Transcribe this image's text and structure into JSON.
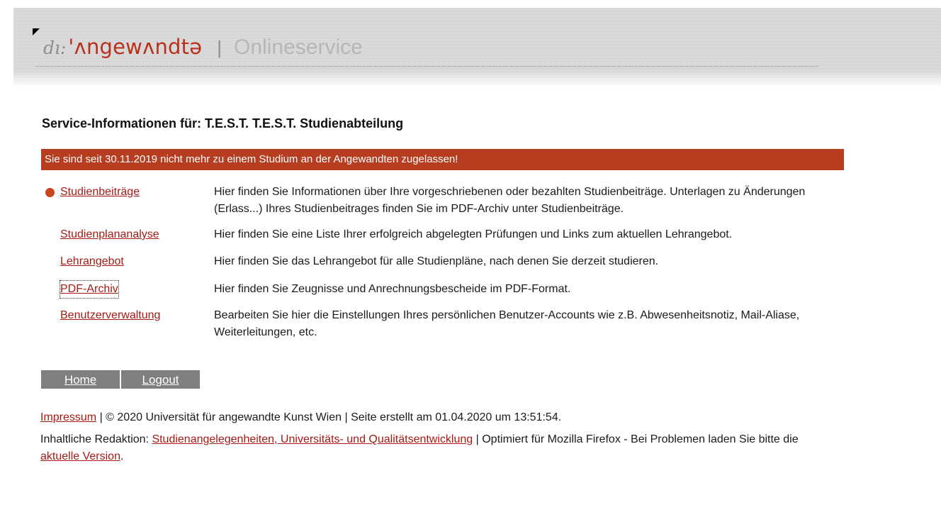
{
  "header": {
    "logo_prefix": "dı:",
    "logo_name": "'ʌngewʌndtə",
    "separator": "|",
    "service_name": "Onlineservice"
  },
  "page_title": "Service-Informationen für: T.E.S.T. T.E.S.T. Studienabteilung",
  "alert": "Sie sind seit 30.11.2019 nicht mehr zu einem Studium an der Angewandten zugelassen!",
  "services": [
    {
      "label": "Studienbeiträge",
      "description": "Hier finden Sie Informationen über Ihre vorgeschriebenen oder bezahlten Studienbeiträge. Unterlagen zu Änderungen (Erlass...) Ihres Studienbeitrages finden Sie im PDF-Archiv unter Studienbeiträge."
    },
    {
      "label": "Studienplananalyse",
      "description": "Hier finden Sie eine Liste Ihrer erfolgreich abgelegten Prüfungen und Links zum aktuellen Lehrangebot."
    },
    {
      "label": "Lehrangebot",
      "description": "Hier finden Sie das Lehrangebot für alle Studienpläne, nach denen Sie derzeit studieren."
    },
    {
      "label": "PDF-Archiv",
      "description": "Hier finden Sie Zeugnisse und Anrechnungsbescheide im PDF-Format."
    },
    {
      "label": "Benutzerverwaltung",
      "description": "Bearbeiten Sie hier die Einstellungen Ihres persönlichen Benutzer-Accounts wie z.B. Abwesenheitsnotiz, Mail-Aliase, Weiterleitungen, etc."
    }
  ],
  "nav": {
    "home": "Home",
    "logout": "Logout"
  },
  "footer": {
    "impressum": "Impressum",
    "line1_text": " | © 2020 Universität für angewandte Kunst Wien | Seite erstellt am 01.04.2020 um 13:51:54.",
    "line2_prefix": "Inhaltliche Redaktion: ",
    "editor_link": "Studienangelegenheiten, Universitäts- und Qualitätsentwicklung",
    "line2_middle": " | Optimiert für Mozilla Firefox - Bei Problemen laden Sie bitte die",
    "version_link": "aktuelle Version",
    "line3_suffix": "."
  },
  "colors": {
    "accent": "#b73d21",
    "link": "#a51b14",
    "nav_bg": "#7f7f7f"
  }
}
